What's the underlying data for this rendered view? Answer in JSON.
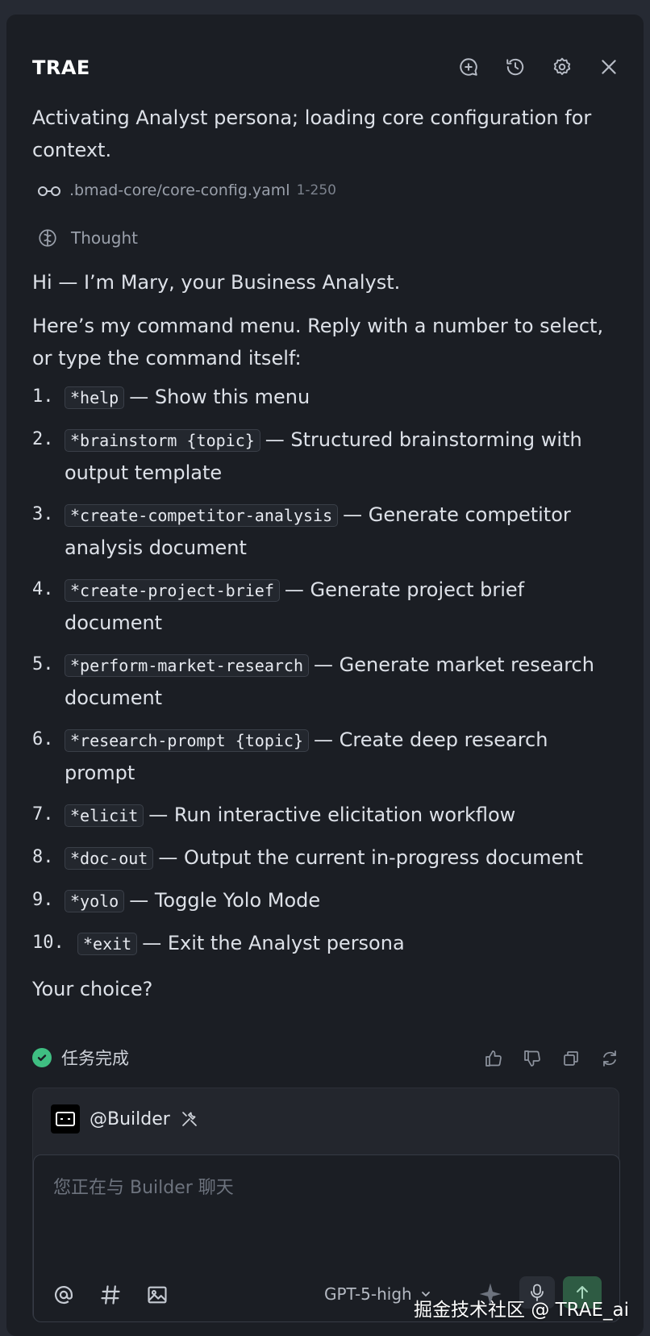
{
  "app": {
    "brand": "TRAE"
  },
  "header": {
    "icons": [
      "new-chat-icon",
      "history-icon",
      "settings-icon",
      "close-icon"
    ]
  },
  "message": {
    "intro": "Activating Analyst persona; loading core configuration for context.",
    "file": {
      "name": ".bmad-core/core-config.yaml",
      "range": "1-250"
    },
    "thought_label": "Thought",
    "greeting": "Hi — I’m Mary, your Business Analyst.",
    "menu_intro": "Here’s my command menu. Reply with a number to select, or type the command itself:",
    "commands": [
      {
        "num": "1.",
        "cmd": "*help",
        "desc": "— Show this menu"
      },
      {
        "num": "2.",
        "cmd": "*brainstorm {topic}",
        "desc": "— Structured brainstorming with output template"
      },
      {
        "num": "3.",
        "cmd": "*create-competitor-analysis",
        "desc": "— Generate competitor analysis document"
      },
      {
        "num": "4.",
        "cmd": "*create-project-brief",
        "desc": "— Generate project brief document"
      },
      {
        "num": "5.",
        "cmd": "*perform-market-research",
        "desc": "— Generate market research document"
      },
      {
        "num": "6.",
        "cmd": "*research-prompt {topic}",
        "desc": "— Create deep research prompt"
      },
      {
        "num": "7.",
        "cmd": "*elicit",
        "desc": "— Run interactive elicitation workflow"
      },
      {
        "num": "8.",
        "cmd": "*doc-out",
        "desc": "— Output the current in-progress document"
      },
      {
        "num": "9.",
        "cmd": "*yolo",
        "desc": "— Toggle Yolo Mode"
      },
      {
        "num": "10.",
        "cmd": "*exit",
        "desc": "— Exit the Analyst persona"
      }
    ],
    "closing": "Your choice?"
  },
  "status": {
    "label": "任务完成",
    "color": "#3fbf82"
  },
  "feedback": {
    "icons": [
      "thumbs-up-icon",
      "thumbs-down-icon",
      "copy-icon",
      "retry-icon"
    ]
  },
  "composer": {
    "agent": "@Builder",
    "placeholder": "您正在与 Builder 聊天",
    "model": "GPT-5-high"
  },
  "watermark": "掘金技术社区 @ TRAE_ai"
}
